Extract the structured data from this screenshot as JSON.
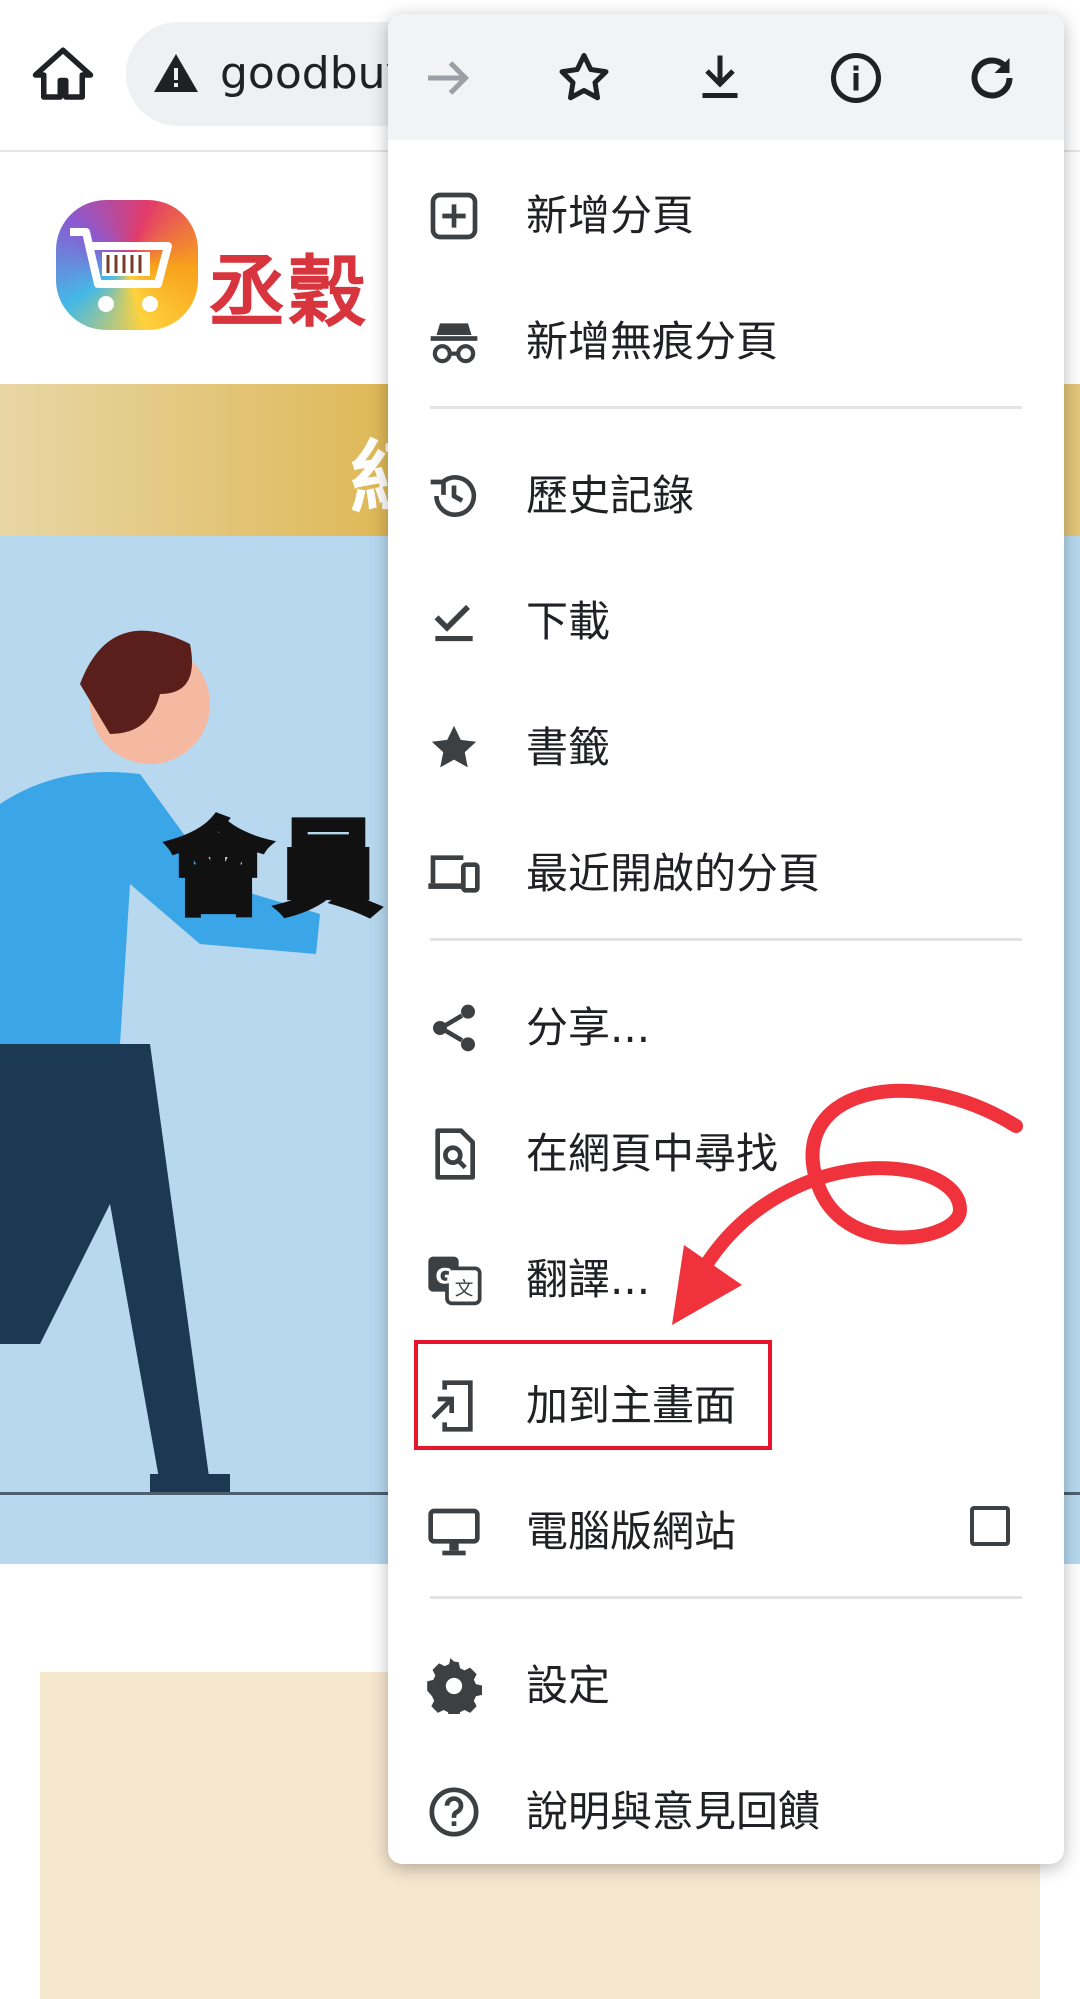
{
  "toolbar": {
    "url_text": "goodbuy",
    "icons": [
      "home-icon",
      "warning-icon"
    ]
  },
  "page": {
    "logo_text": "丞穀",
    "hero_title": "會員",
    "hero_band_text": "紅"
  },
  "menu": {
    "top_icons": [
      "forward-icon",
      "star-outline-icon",
      "download-icon",
      "info-icon",
      "refresh-icon"
    ],
    "items": [
      {
        "label": "新增分頁",
        "icon": "new-tab-icon"
      },
      {
        "label": "新增無痕分頁",
        "icon": "incognito-icon"
      },
      {
        "label": "歷史記錄",
        "icon": "history-icon"
      },
      {
        "label": "下載",
        "icon": "downloads-icon"
      },
      {
        "label": "書籤",
        "icon": "bookmark-star-icon"
      },
      {
        "label": "最近開啟的分頁",
        "icon": "recent-tabs-icon"
      },
      {
        "label": "分享...",
        "icon": "share-icon"
      },
      {
        "label": "在網頁中尋找",
        "icon": "find-in-page-icon"
      },
      {
        "label": "翻譯...",
        "icon": "translate-icon"
      },
      {
        "label": "加到主畫面",
        "icon": "add-to-home-icon"
      },
      {
        "label": "電腦版網站",
        "icon": "desktop-icon",
        "checkbox_checked": false
      },
      {
        "label": "設定",
        "icon": "settings-gear-icon"
      },
      {
        "label": "說明與意見回饋",
        "icon": "help-icon"
      }
    ]
  },
  "annotation": {
    "highlight_color": "#e5152c",
    "arrow_color": "#f0323c"
  }
}
